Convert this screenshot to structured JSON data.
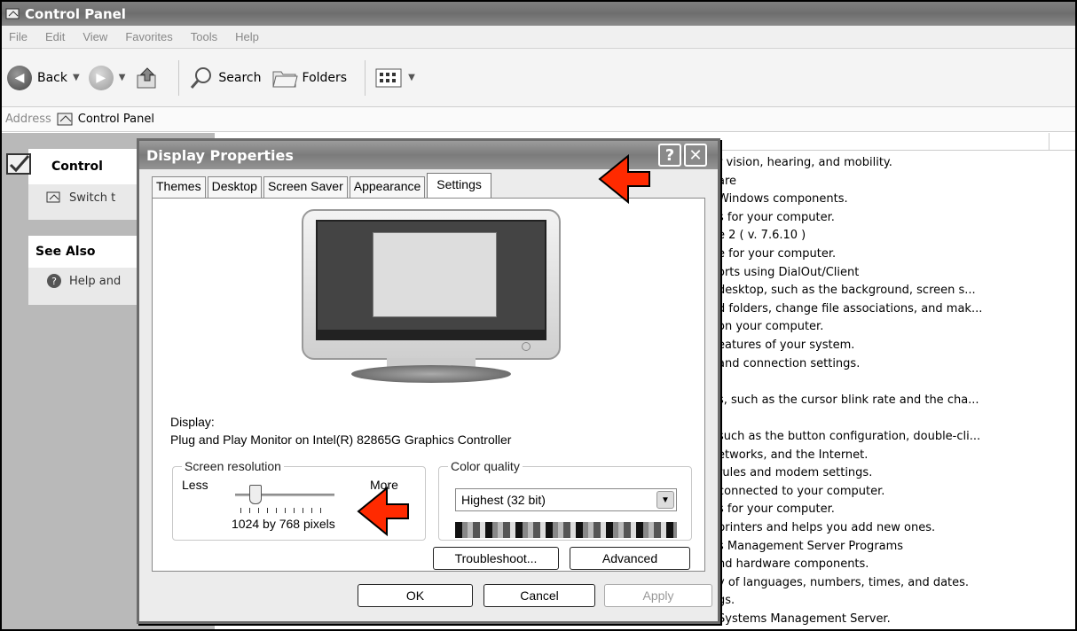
{
  "window": {
    "title": "Control Panel"
  },
  "menu": [
    "File",
    "Edit",
    "View",
    "Favorites",
    "Tools",
    "Help"
  ],
  "toolbar": {
    "back": "Back",
    "search": "Search",
    "folders": "Folders"
  },
  "address": {
    "label": "Address",
    "value": "Control Panel"
  },
  "sidepanel": {
    "box1_title": "Control",
    "box1_item": "Switch t",
    "box2_title": "See Also",
    "box2_item": "Help and"
  },
  "content_descriptions": [
    "r vision, hearing, and mobility.",
    "are",
    "Windows components.",
    "s for your computer.",
    "e 2 ( v. 7.6.10 )",
    "e for your computer.",
    "orts using DialOut/Client",
    "desktop, such as the background, screen s...",
    "d folders, change file associations, and mak...",
    "on your computer.",
    "eatures of your system.",
    "and connection settings.",
    "",
    "s, such as the cursor blink rate and the cha...",
    "",
    "such as the button configuration, double-cli...",
    "etworks, and the Internet.",
    "rules and modem settings.",
    "connected to your computer.",
    "s for your computer.",
    "printers and helps you add new ones.",
    "s Management Server Programs",
    "nd hardware components.",
    "y of languages, numbers, times, and dates.",
    "gs.",
    "Systems Management Server."
  ],
  "dialog": {
    "title": "Display Properties",
    "help_btn": "?",
    "close_btn": "✕",
    "tabs": [
      "Themes",
      "Desktop",
      "Screen Saver",
      "Appearance",
      "Settings"
    ],
    "active_tab": "Settings",
    "display_label": "Display:",
    "display_value": "Plug and Play Monitor on Intel(R) 82865G Graphics Controller",
    "resolution": {
      "group": "Screen resolution",
      "less": "Less",
      "more": "More",
      "value": "1024 by 768 pixels"
    },
    "color": {
      "group": "Color quality",
      "value": "Highest (32 bit)"
    },
    "troubleshoot": "Troubleshoot...",
    "advanced": "Advanced",
    "ok": "OK",
    "cancel": "Cancel",
    "apply": "Apply"
  }
}
